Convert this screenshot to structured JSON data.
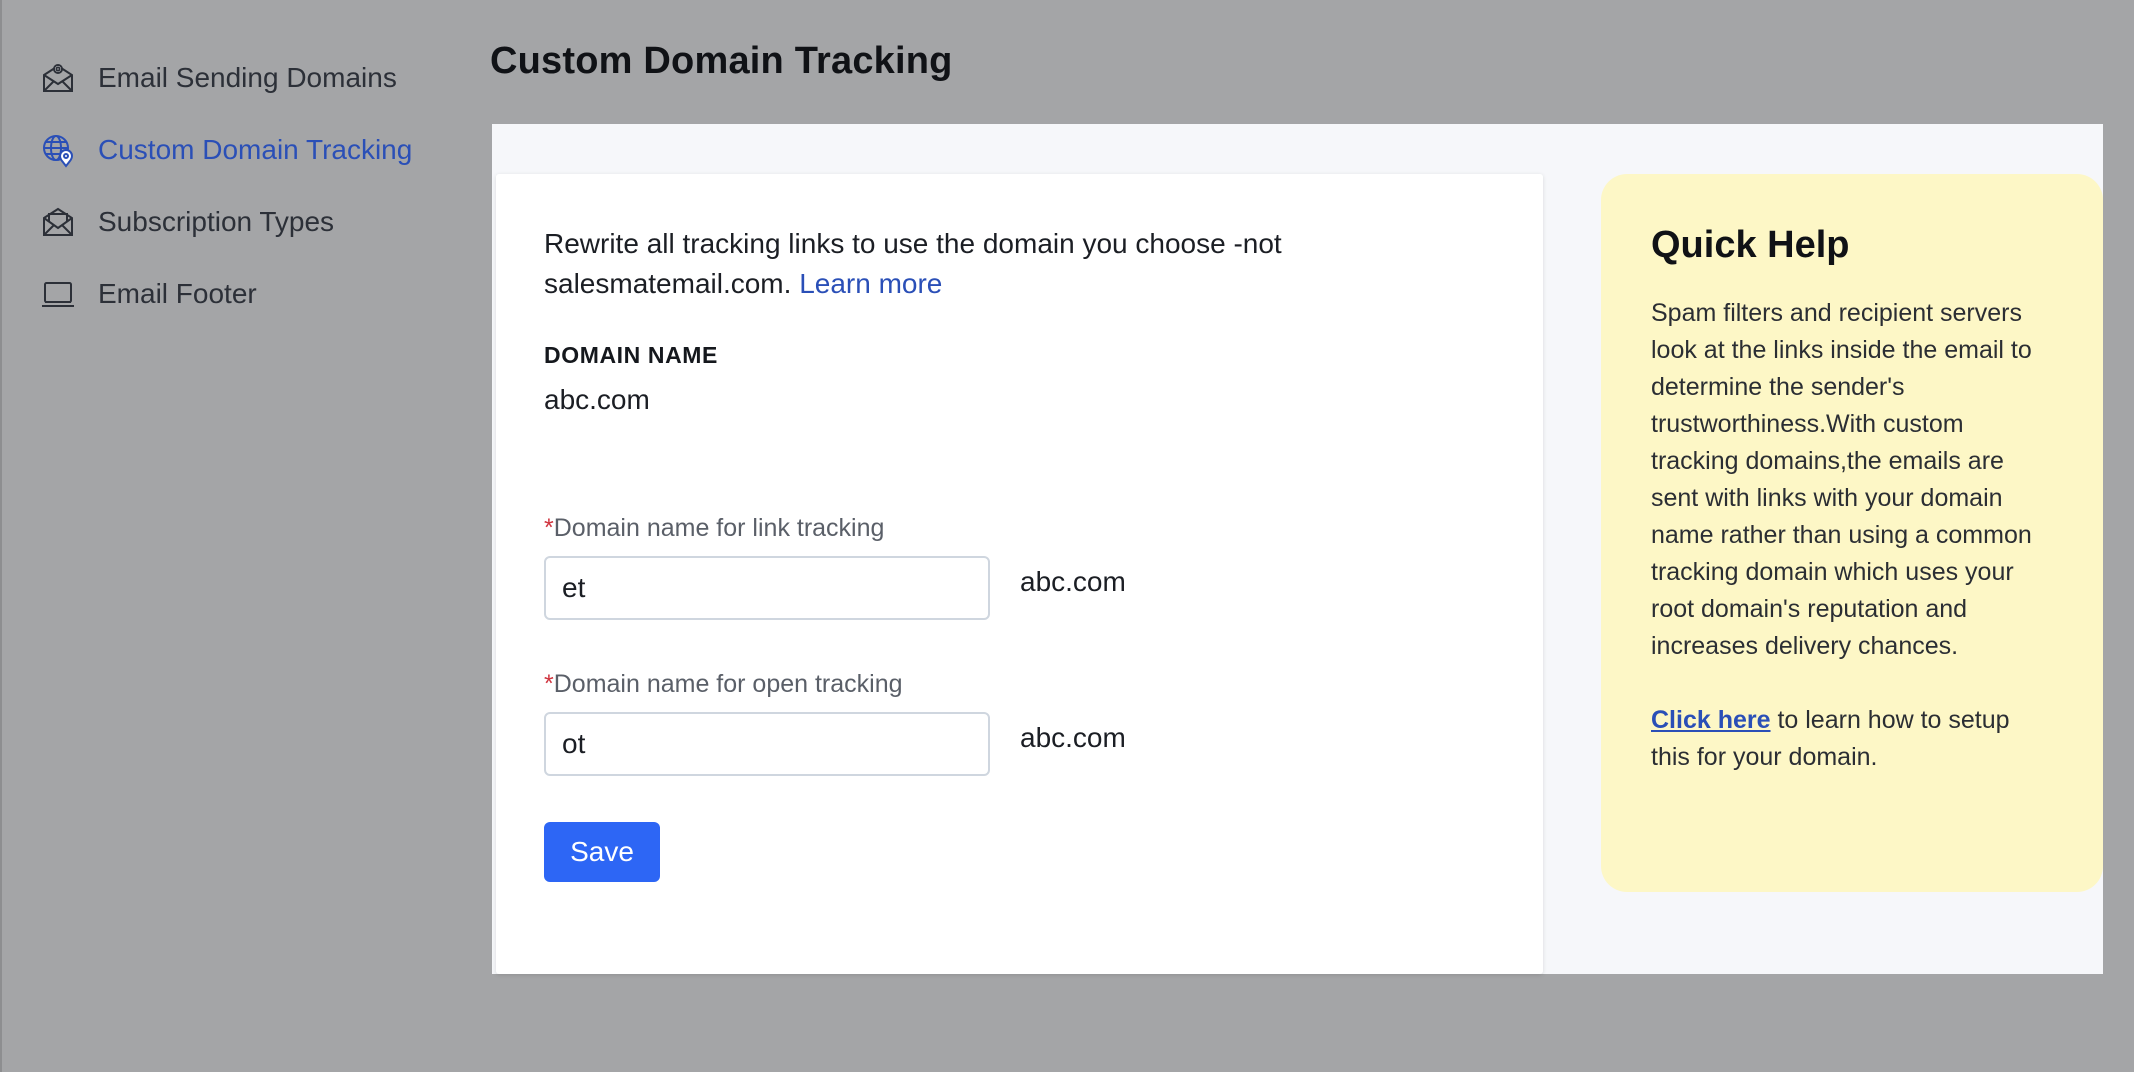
{
  "page": {
    "title": "Custom Domain Tracking"
  },
  "sidebar": {
    "items": [
      {
        "label": "Email Sending Domains",
        "icon": "envelope-at-icon",
        "active": false
      },
      {
        "label": "Custom Domain Tracking",
        "icon": "globe-pin-icon",
        "active": true
      },
      {
        "label": "Subscription Types",
        "icon": "envelope-open-icon",
        "active": false
      },
      {
        "label": "Email Footer",
        "icon": "laptop-icon",
        "active": false
      }
    ]
  },
  "form": {
    "intro_text": "Rewrite all tracking links to use the domain you choose -not salesmatemail.com.",
    "learn_more": "Learn more",
    "domain_name_label": "DOMAIN NAME",
    "domain_name_value": "abc.com",
    "required_mark": "*",
    "link_tracking": {
      "label": "Domain name for link tracking",
      "value": "et",
      "suffix": "abc.com"
    },
    "open_tracking": {
      "label": "Domain name for open tracking",
      "value": "ot",
      "suffix": "abc.com"
    },
    "save_label": "Save"
  },
  "help": {
    "title": "Quick Help",
    "body": "Spam filters and recipient servers look at the links inside the email to determine the sender's trustworthiness.With custom tracking domains,the emails are sent with links with your domain name rather than using a common tracking domain which uses your root domain's reputation and increases delivery chances.",
    "cta_link": "Click here",
    "cta_rest": " to learn how to setup this for your domain."
  },
  "colors": {
    "accent": "#2a4fb7",
    "button": "#2d66f5",
    "help_bg": "#fdf7c6",
    "backdrop": "#a4a5a7",
    "required": "#d0343f"
  }
}
